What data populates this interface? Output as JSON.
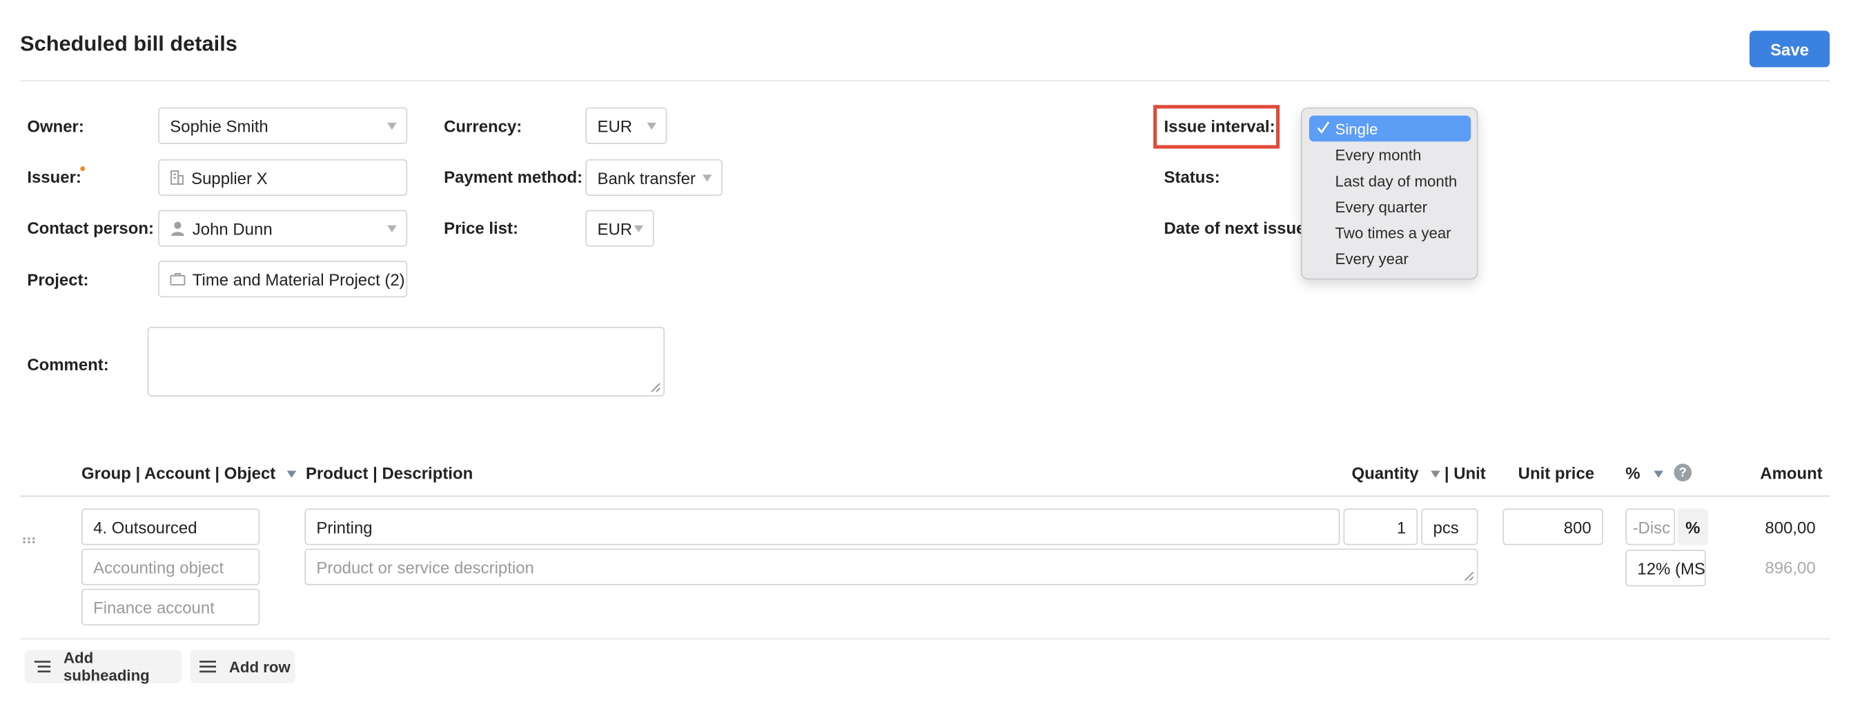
{
  "header": {
    "title": "Scheduled bill details",
    "save_label": "Save"
  },
  "form": {
    "owner": {
      "label": "Owner:",
      "value": "Sophie Smith"
    },
    "issuer": {
      "label": "Issuer:",
      "value": "Supplier X"
    },
    "contact": {
      "label": "Contact person:",
      "value": "John Dunn"
    },
    "project": {
      "label": "Project:",
      "value": "Time and Material Project (2)"
    },
    "currency": {
      "label": "Currency:",
      "value": "EUR"
    },
    "payment": {
      "label": "Payment method:",
      "value": "Bank transfer"
    },
    "pricelist": {
      "label": "Price list:",
      "value": "EUR"
    },
    "comment": {
      "label": "Comment:",
      "value": ""
    },
    "issue_interval": {
      "label": "Issue interval:"
    },
    "status": {
      "label": "Status:"
    },
    "next_issue": {
      "label": "Date of next issue:"
    }
  },
  "interval_dropdown": {
    "selected": "Single",
    "options": [
      "Single",
      "Every month",
      "Last day of month",
      "Every quarter",
      "Two times a year",
      "Every year"
    ]
  },
  "table": {
    "headers": {
      "group": "Group | Account | Object",
      "product": "Product | Description",
      "quantity": "Quantity",
      "unit": "| Unit",
      "unit_price": "Unit price",
      "percent": "%",
      "help": "?",
      "amount": "Amount"
    },
    "row": {
      "group": "4. Outsourced",
      "accounting_placeholder": "Accounting object",
      "finance_placeholder": "Finance account",
      "product": "Printing",
      "description_placeholder": "Product or service description",
      "quantity": "1",
      "unit": "pcs",
      "unit_price": "800",
      "discount_placeholder": "-Disc",
      "discount_unit": "%",
      "vat": "12% (MS",
      "amount": "800,00",
      "amount_with_vat": "896,00"
    }
  },
  "actions": {
    "add_subheading": "Add subheading",
    "add_row": "Add row"
  },
  "colors": {
    "accent": "#3b82e0",
    "highlight": "#e04a3a",
    "selection": "#5c9df6"
  }
}
